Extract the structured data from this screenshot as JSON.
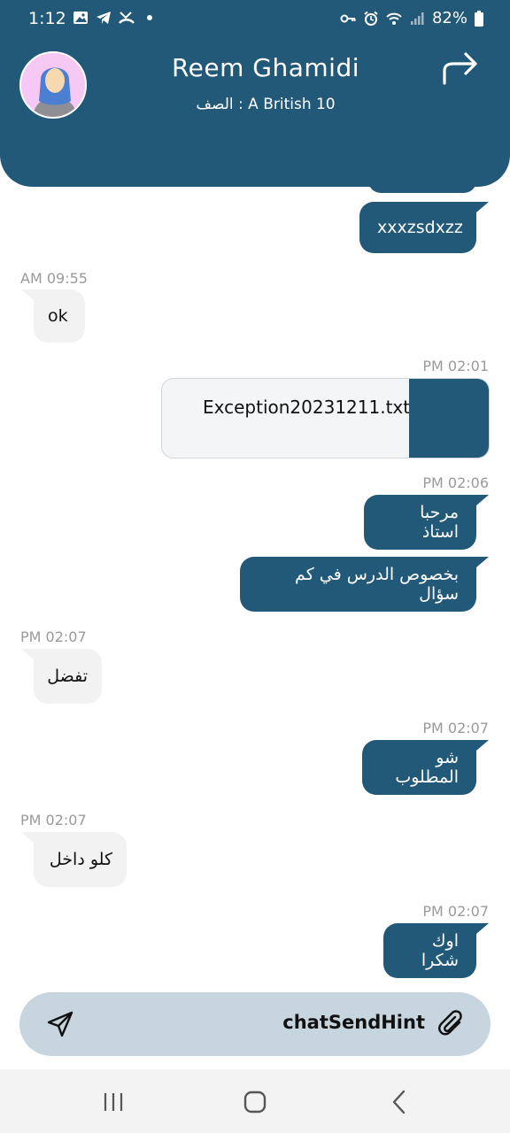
{
  "status_bar": {
    "time": "1:12",
    "battery": "82%"
  },
  "header": {
    "name": "Reem Ghamidi",
    "class_label": "الصف : A British 10"
  },
  "messages": {
    "m0": {
      "text": "xxxzsdxzz"
    },
    "m1": {
      "time": "AM 09:55",
      "text": "ok"
    },
    "m2": {
      "time": "PM 02:01",
      "file_name": "Exception20231211.txt"
    },
    "m3": {
      "time": "PM 02:06",
      "text": "مرحبا استاذ"
    },
    "m4": {
      "text": "بخصوص الدرس في كم سؤال"
    },
    "m5": {
      "time": "PM 02:07",
      "text": "تفضل"
    },
    "m6": {
      "time": "PM 02:07",
      "text": "شو المطلوب"
    },
    "m7": {
      "time": "PM 02:07",
      "text": "كلو داخل"
    },
    "m8": {
      "time": "PM 02:07",
      "text": "اوك شكرا"
    }
  },
  "input": {
    "hint": "chatSendHint"
  },
  "icons": {
    "forward": "forward-arrow-icon",
    "send": "send-icon",
    "attach": "paperclip-icon",
    "nav_recent": "recent-apps-icon",
    "nav_home": "home-icon",
    "nav_back": "back-icon"
  },
  "colors": {
    "primary": "#225878",
    "incoming_bubble": "#f2f2f2",
    "input_bar": "#c7d5df",
    "timestamp": "#9a9a9a"
  }
}
